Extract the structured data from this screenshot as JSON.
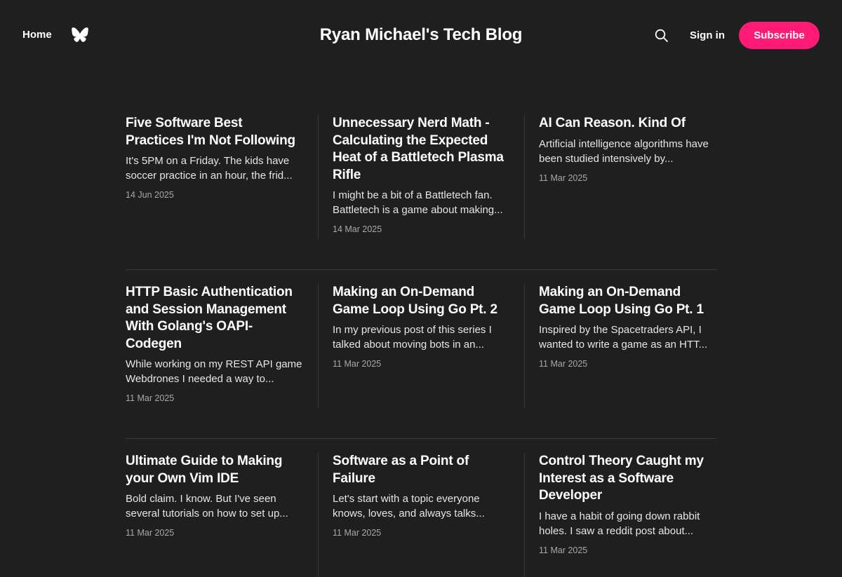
{
  "header": {
    "home_label": "Home",
    "site_title": "Ryan Michael's Tech Blog",
    "signin_label": "Sign in",
    "subscribe_label": "Subscribe",
    "social_icon": "butterfly-icon",
    "search_icon": "search-icon"
  },
  "colors": {
    "background": "#1f1f1f",
    "accent": "#ff1a75"
  },
  "posts": [
    {
      "title": "Five Software Best Practices I'm Not Following",
      "excerpt": "It's 5PM on a Friday. The kids have soccer practice in an hour, the frid...",
      "date": "14 Jun 2025"
    },
    {
      "title": "Unnecessary Nerd Math - Calculating the Expected Heat of a Battletech Plasma Rifle",
      "excerpt": "I might be a bit of a Battletech fan. Battletech is a game about making...",
      "date": "14 Mar 2025"
    },
    {
      "title": "AI Can Reason. Kind Of",
      "excerpt": "Artificial intelligence algorithms have been studied intensively by...",
      "date": "11 Mar 2025"
    },
    {
      "title": "HTTP Basic Authentication and Session Management With Golang's OAPI-Codegen",
      "excerpt": "While working on my REST API game Webdrones I needed a way to...",
      "date": "11 Mar 2025"
    },
    {
      "title": "Making an On-Demand Game Loop Using Go Pt. 2",
      "excerpt": "In my previous post of this series I talked about moving bots in an...",
      "date": "11 Mar 2025"
    },
    {
      "title": "Making an On-Demand Game Loop Using Go Pt. 1",
      "excerpt": "Inspired by the Spacetraders API, I wanted to write a game as an HTT...",
      "date": "11 Mar 2025"
    },
    {
      "title": "Ultimate Guide to Making your Own Vim IDE",
      "excerpt": "Bold claim. I know. But I've seen several tutorials on how to set up...",
      "date": "11 Mar 2025"
    },
    {
      "title": "Software as a Point of Failure",
      "excerpt": "Let's start with a topic everyone knows, loves, and always talks...",
      "date": "11 Mar 2025"
    },
    {
      "title": "Control Theory Caught my Interest as a Software Developer",
      "excerpt": "I have a habit of going down rabbit holes. I saw a reddit post about...",
      "date": "11 Mar 2025"
    }
  ]
}
